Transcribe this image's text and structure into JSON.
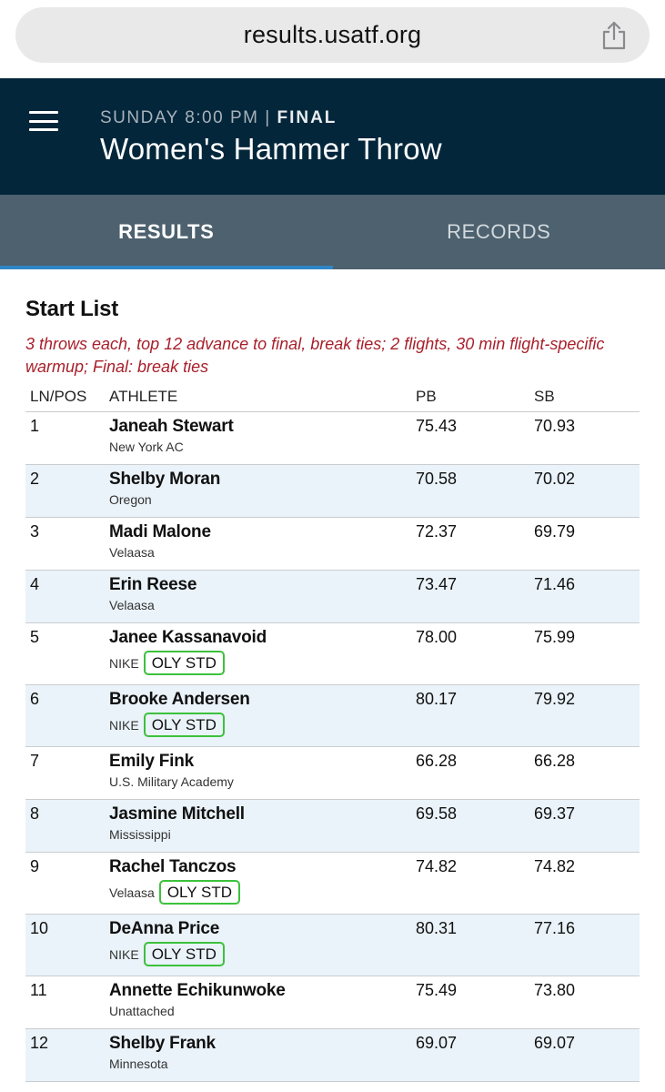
{
  "browser": {
    "url": "results.usatf.org"
  },
  "header": {
    "meta_time": "SUNDAY 8:00 PM |",
    "meta_status": "FINAL",
    "title": "Women's Hammer Throw"
  },
  "tabs": [
    {
      "label": "RESULTS",
      "active": true
    },
    {
      "label": "RECORDS",
      "active": false
    }
  ],
  "start_list": {
    "title": "Start List",
    "note": "3 throws each, top 12 advance to final, break ties; 2 flights, 30 min flight-specific warmup; Final: break ties",
    "columns": {
      "pos": "LN/POS",
      "athlete": "ATHLETE",
      "pb": "PB",
      "sb": "SB"
    },
    "rows": [
      {
        "pos": "1",
        "name": "Janeah Stewart",
        "team": "New York AC",
        "badge": "",
        "pb": "75.43",
        "sb": "70.93"
      },
      {
        "pos": "2",
        "name": "Shelby Moran",
        "team": "Oregon",
        "badge": "",
        "pb": "70.58",
        "sb": "70.02"
      },
      {
        "pos": "3",
        "name": "Madi Malone",
        "team": "Velaasa",
        "badge": "",
        "pb": "72.37",
        "sb": "69.79"
      },
      {
        "pos": "4",
        "name": "Erin Reese",
        "team": "Velaasa",
        "badge": "",
        "pb": "73.47",
        "sb": "71.46"
      },
      {
        "pos": "5",
        "name": "Janee Kassanavoid",
        "team": "NIKE",
        "badge": "OLY STD",
        "pb": "78.00",
        "sb": "75.99"
      },
      {
        "pos": "6",
        "name": "Brooke Andersen",
        "team": "NIKE",
        "badge": "OLY STD",
        "pb": "80.17",
        "sb": "79.92"
      },
      {
        "pos": "7",
        "name": "Emily Fink",
        "team": "U.S. Military Academy",
        "badge": "",
        "pb": "66.28",
        "sb": "66.28"
      },
      {
        "pos": "8",
        "name": "Jasmine Mitchell",
        "team": "Mississippi",
        "badge": "",
        "pb": "69.58",
        "sb": "69.37"
      },
      {
        "pos": "9",
        "name": "Rachel Tanczos",
        "team": "Velaasa",
        "badge": "OLY STD",
        "pb": "74.82",
        "sb": "74.82"
      },
      {
        "pos": "10",
        "name": "DeAnna Price",
        "team": "NIKE",
        "badge": "OLY STD",
        "pb": "80.31",
        "sb": "77.16"
      },
      {
        "pos": "11",
        "name": "Annette Echikunwoke",
        "team": "Unattached",
        "badge": "",
        "pb": "75.49",
        "sb": "73.80"
      },
      {
        "pos": "12",
        "name": "Shelby Frank",
        "team": "Minnesota",
        "badge": "",
        "pb": "69.07",
        "sb": "69.07"
      }
    ]
  },
  "colors": {
    "header_bg": "#03263b",
    "tab_bg": "#4d616e",
    "tab_indicator": "#2f86c6",
    "note_red": "#a81f2a",
    "badge_green": "#3cc13c",
    "row_alt": "#eaf3f9"
  },
  "icons": {
    "share": "share-icon",
    "menu": "hamburger-menu-icon"
  }
}
